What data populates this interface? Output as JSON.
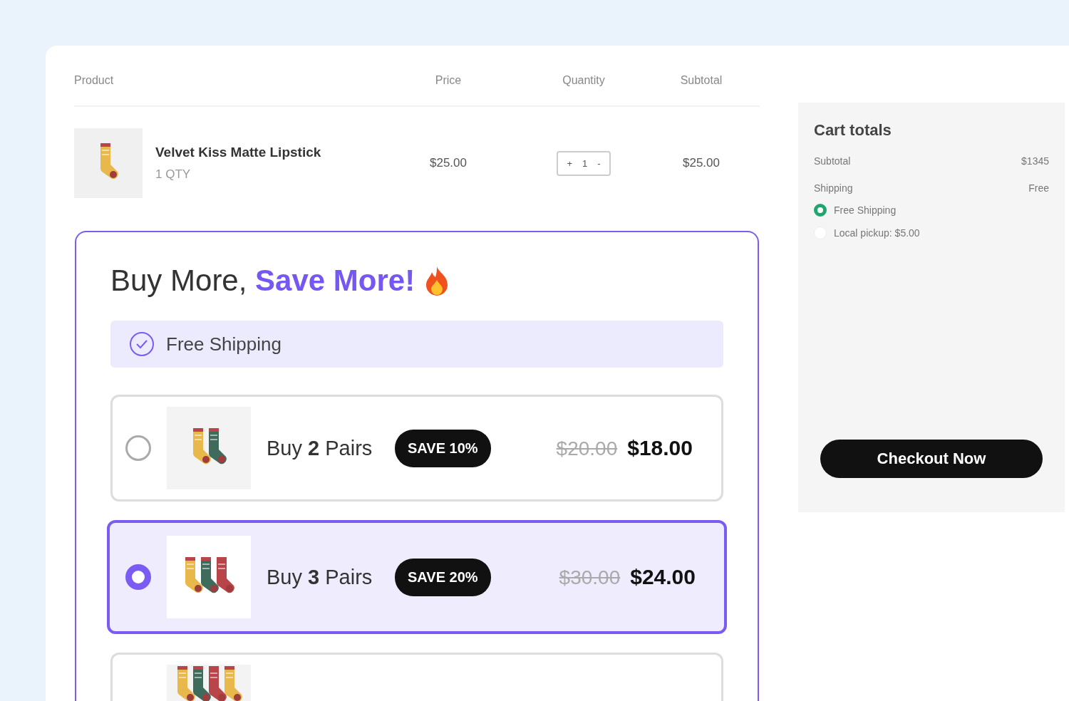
{
  "cart_table": {
    "columns": [
      "Product",
      "Price",
      "Quantity",
      "Subtotal"
    ],
    "rows": [
      {
        "name": "Velvet Kiss Matte Lipstick",
        "qty_note": "1 QTY",
        "price": "$25.00",
        "stepper": {
          "plus": "+",
          "value": "1",
          "minus": "-"
        },
        "subtotal": "$25.00"
      }
    ]
  },
  "offer": {
    "title": "Buy More, ",
    "title_highlight": "Save More!",
    "perk": "Free Shipping",
    "options": [
      {
        "selected": false,
        "label": "Buy **2** Pairs",
        "badge": "SAVE 10%",
        "old_price": "$20.00",
        "price": "$18.00"
      },
      {
        "selected": true,
        "label": "Buy **3** Pairs",
        "badge": "SAVE 20%",
        "old_price": "$30.00",
        "price": "$24.00"
      },
      {
        "selected": false
      }
    ]
  },
  "cart_totals": {
    "title": "Cart totals",
    "lines": [
      {
        "label": "Subtotal",
        "value": "$1345"
      },
      {
        "label": "Shipping",
        "value": "Free"
      }
    ],
    "shipping_options": [
      {
        "label": "Free Shipping",
        "selected": true
      },
      {
        "label": "Local pickup: $5.00",
        "selected": false
      }
    ],
    "checkout": "Checkout Now"
  }
}
